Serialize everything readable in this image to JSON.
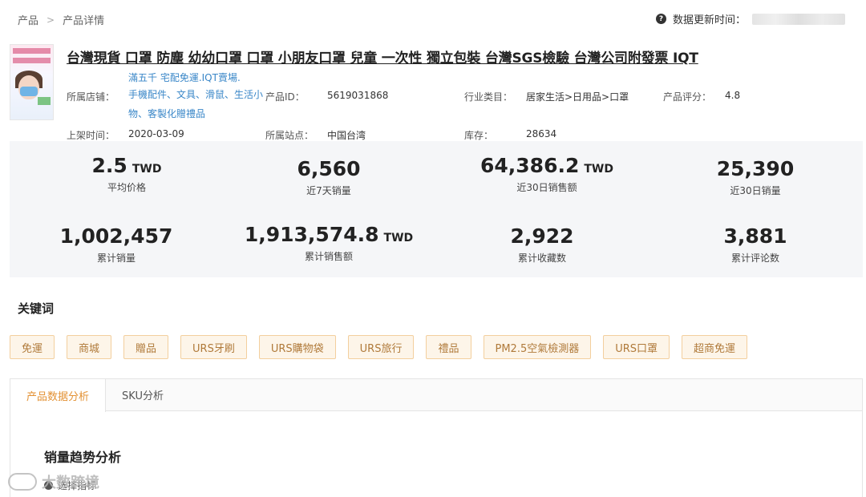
{
  "breadcrumb": [
    "产品",
    "产品详情"
  ],
  "update": {
    "label": "数据更新时间："
  },
  "product": {
    "title": "台灣現貨 口罩 防塵 幼幼口罩 口罩 小朋友口罩 兒童 一次性 獨立包裝 台灣SGS檢驗 台灣公司附發票 IQT",
    "shop_name": "滿五千 宅配免運.IQT賣場.",
    "info": {
      "shop_label": "所属店铺：",
      "shop_categories": "手機配件、文具、滑鼠、生活小物、客製化贈禮品",
      "id_label": "产品ID：",
      "id_value": "5619031868",
      "industry_label": "行业类目：",
      "industry_value": "居家生活>日用品>口罩",
      "rating_label": "产品评分：",
      "rating_value": "4.8",
      "listed_label": "上架时间：",
      "listed_value": "2020-03-09",
      "site_label": "所属站点：",
      "site_value": "中国台湾",
      "stock_label": "库存：",
      "stock_value": "28634"
    }
  },
  "stats": [
    {
      "value": "2.5",
      "unit": "TWD",
      "label": "平均价格"
    },
    {
      "value": "6,560",
      "unit": "",
      "label": "近7天销量"
    },
    {
      "value": "64,386.2",
      "unit": "TWD",
      "label": "近30日销售额"
    },
    {
      "value": "25,390",
      "unit": "",
      "label": "近30日销量"
    },
    {
      "value": "1,002,457",
      "unit": "",
      "label": "累计销量"
    },
    {
      "value": "1,913,574.8",
      "unit": "TWD",
      "label": "累计销售额"
    },
    {
      "value": "2,922",
      "unit": "",
      "label": "累计收藏数"
    },
    {
      "value": "3,881",
      "unit": "",
      "label": "累计评论数"
    }
  ],
  "keywords": {
    "title": "关键词",
    "tags": [
      "免運",
      "商城",
      "贈品",
      "URS牙刷",
      "URS購物袋",
      "URS旅行",
      "禮品",
      "PM2.5空氣檢測器",
      "URS口罩",
      "超商免運"
    ]
  },
  "tabs": [
    {
      "label": "产品数据分析",
      "active": true
    },
    {
      "label": "SKU分析",
      "active": false
    }
  ],
  "section": {
    "title": "销量趋势分析",
    "sub": "选择指标"
  },
  "watermark": {
    "text": "大数跨境"
  },
  "colors": {
    "accent": "#e39133",
    "link": "#3a87c8",
    "tag_bg": "#fdf5e9",
    "tag_border": "#f3cf9e"
  }
}
